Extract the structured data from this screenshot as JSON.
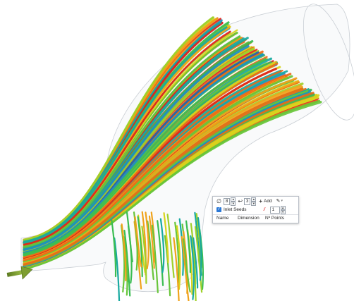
{
  "seed_panel": {
    "diameter_icon": "diameter-icon",
    "diameter_value": "8",
    "spacing_icon": "reverse-arrow-icon",
    "spacing_value": "3",
    "add_label": "Add",
    "pen_icon": "pen-icon",
    "inlet_seeds_checked": true,
    "inlet_seeds_label": "Inlet Seeds",
    "count_icon": "red-lines-icon",
    "count_value": "1",
    "columns": [
      "Name",
      "Dimension",
      "Nº Points"
    ]
  },
  "colors": {
    "streamline_low": "#1f5fb0",
    "streamline_mid": "#2fb43c",
    "streamline_high": "#e0201a",
    "inlet_arrow": "#6f8e2b"
  }
}
